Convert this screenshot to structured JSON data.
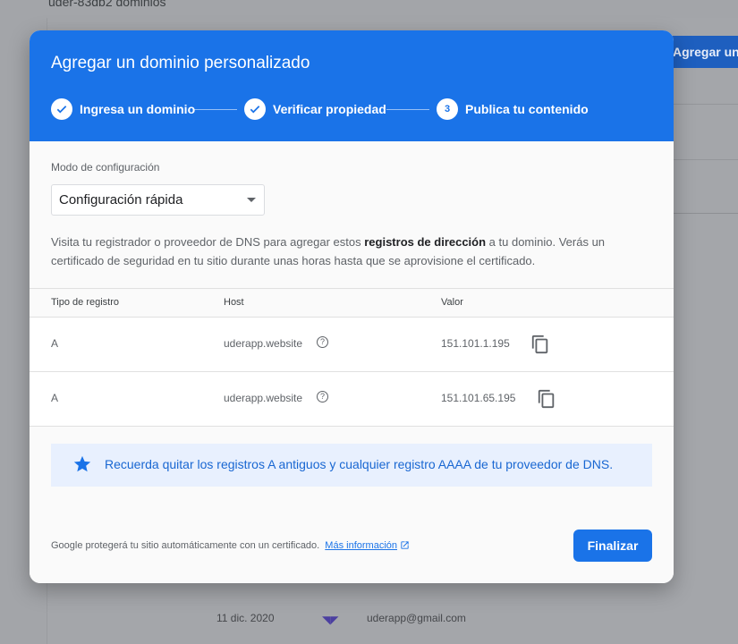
{
  "background": {
    "title": "uder-83db2 dominios",
    "add_button": "Agregar un dominio",
    "footer_date": "11 dic. 2020",
    "footer_email": "uderapp@gmail.com"
  },
  "dialog": {
    "title": "Agregar un dominio personalizado",
    "steps": [
      {
        "label": "Ingresa un dominio",
        "state": "done"
      },
      {
        "label": "Verificar propiedad",
        "state": "done"
      },
      {
        "label": "Publica tu contenido",
        "state": "current",
        "number": "3"
      }
    ],
    "mode_label": "Modo de configuración",
    "mode_value": "Configuración rápida",
    "description_before": "Visita tu registrador o proveedor de DNS para agregar estos ",
    "description_bold": "registros de dirección",
    "description_after": " a tu dominio. Verás un certificado de seguridad en tu sitio durante unas horas hasta que se aprovisione el certificado.",
    "table": {
      "headers": {
        "type": "Tipo de registro",
        "host": "Host",
        "value": "Valor"
      },
      "rows": [
        {
          "type": "A",
          "host": "uderapp.website",
          "value": "151.101.1.195"
        },
        {
          "type": "A",
          "host": "uderapp.website",
          "value": "151.101.65.195"
        }
      ]
    },
    "notice": "Recuerda quitar los registros A antiguos y cualquier registro AAAA de tu proveedor de DNS.",
    "footer_text": "Google protegerá tu sitio automáticamente con un certificado.",
    "footer_link": "Más información",
    "finish_button": "Finalizar"
  },
  "colors": {
    "accent": "#1a73e8",
    "notice_bg": "#e8f0fe",
    "overlay": "#a3a5a9"
  },
  "icons": [
    "check-icon",
    "help-circle-icon",
    "copy-icon",
    "star-icon",
    "open-in-new-icon",
    "dropdown-caret-icon"
  ]
}
